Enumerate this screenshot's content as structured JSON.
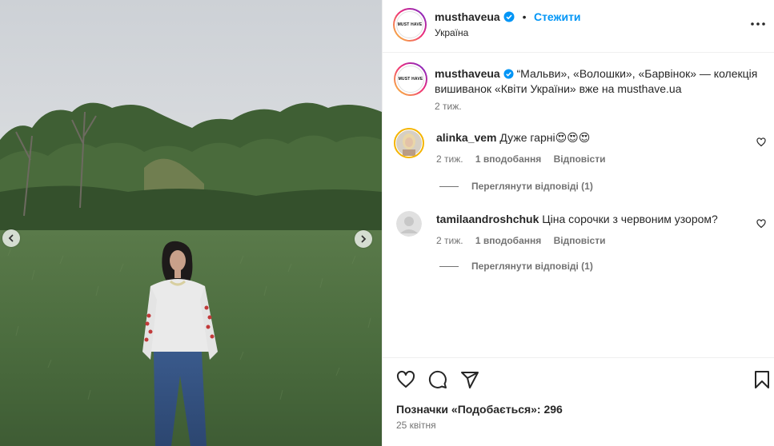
{
  "post": {
    "username": "musthaveua",
    "follow_label": "Стежити",
    "separator": "•",
    "location": "Україна",
    "avatar_text": "MUST HAVE",
    "caption": "“Мальви», «Волошки», «Барвінок» — колекція вишиванок «Квіти України» вже на musthave.ua",
    "caption_time": "2 тиж.",
    "likes_text": "Позначки «Подобається»: 296",
    "date": "25 квітня"
  },
  "comments": [
    {
      "username": "alinka_vem",
      "text": "Дуже гарні😍😍😍",
      "time": "2 тиж.",
      "likes": "1 вподобання",
      "reply": "Відповісти",
      "view_replies": "Переглянути відповіді (1)"
    },
    {
      "username": "tamilaandroshchuk",
      "text": "Ціна сорочки з червоним узором?",
      "time": "2 тиж.",
      "likes": "1 вподобання",
      "reply": "Відповісти",
      "view_replies": "Переглянути відповіді (1)"
    }
  ],
  "icons": {
    "verified": "verified-badge-icon",
    "more": "more-options-icon",
    "like": "heart-icon",
    "comment": "comment-icon",
    "share": "share-icon",
    "save": "bookmark-icon",
    "prev": "chevron-left-icon",
    "next": "chevron-right-icon"
  },
  "colors": {
    "link": "#0095f6",
    "verified": "#0095f6",
    "muted": "#737373",
    "text": "#262626"
  }
}
